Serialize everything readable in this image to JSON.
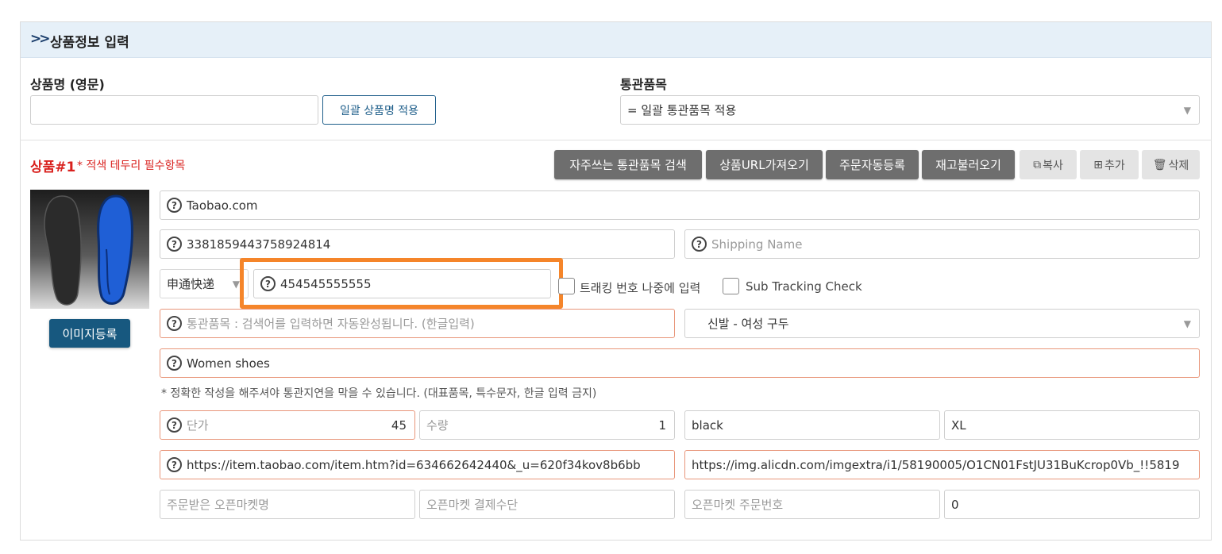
{
  "header": {
    "title": "상품정보 입력"
  },
  "product_name": {
    "label": "상품명 (영문)",
    "value": "",
    "apply_button": "일괄 상품명 적용"
  },
  "customs": {
    "label": "통관품목",
    "select_value": "= 일괄 통관품목 적용"
  },
  "item": {
    "title": "상품#1",
    "required_note": "* 적색 테두리 필수항목",
    "buttons": {
      "search_customs": "자주쓰는 통관품목 검색",
      "fetch_url": "상품URL가져오기",
      "auto_order": "주문자동등록",
      "reload_stock": "재고불러오기",
      "copy": "복사",
      "add": "추가",
      "delete": "삭제"
    },
    "image_button": "이미지등록",
    "site": "Taobao.com",
    "order_number": "3381859443758924814",
    "shipping_name_placeholder": "Shipping Name",
    "courier": "申通快递",
    "tracking_number": "454545555555",
    "tracking_later_label": "트래킹 번호 나중에 입력",
    "sub_tracking_label": "Sub Tracking Check",
    "customs_item_placeholder": "통관품목 : 검색어를 입력하면 자동완성됩니다. (한글입력)",
    "customs_category": "신발 - 여성 구두",
    "english_name": "Women shoes",
    "warning": "* 정확한 작성을 해주셔야 통관지연을 막을 수 있습니다. (대표품목, 특수문자, 한글 입력 금지)",
    "unit_price_label": "단가",
    "unit_price": "45",
    "quantity_label": "수량",
    "quantity": "1",
    "color": "black",
    "size": "XL",
    "product_url": "https://item.taobao.com/item.htm?id=634662642440&_u=620f34kov8b6bb",
    "image_url": "https://img.alicdn.com/imgextra/i1/58190005/O1CN01FstJU31BuKcrop0Vb_!!5819",
    "market_placeholder": "주문받은 오픈마켓명",
    "payment_placeholder": "오픈마켓 결제수단",
    "market_order_placeholder": "오픈마켓 주문번호",
    "extra_value": "0"
  },
  "colors": {
    "highlight": "#f5852a",
    "required_border": "#e8967a",
    "title_red": "#d9211e",
    "primary_blue": "#17587f"
  }
}
